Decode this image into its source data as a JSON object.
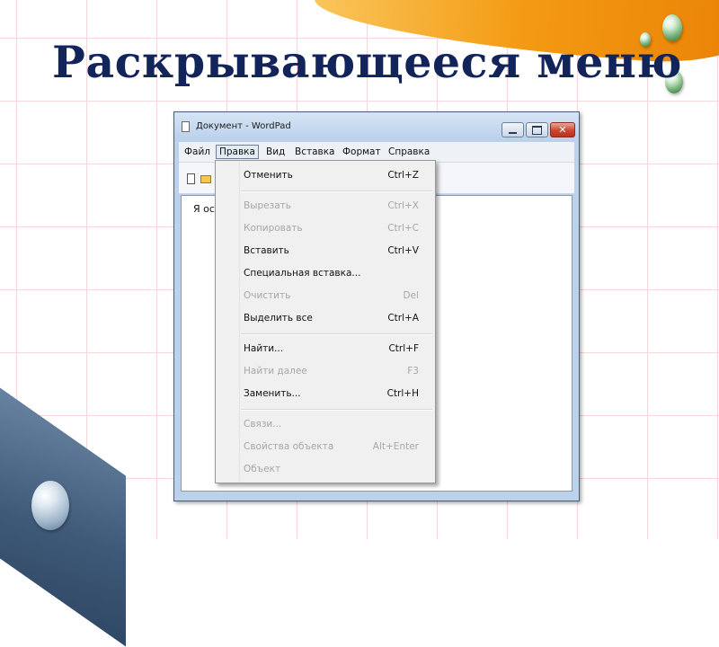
{
  "slide": {
    "title": "Раскрывающееся меню"
  },
  "window": {
    "title": "Документ - WordPad",
    "close_glyph": "✕"
  },
  "menubar": {
    "items": [
      "Файл",
      "Правка",
      "Вид",
      "Вставка",
      "Формат",
      "Справка"
    ],
    "active": "Правка"
  },
  "editor": {
    "text": "Я ос"
  },
  "dropdown": {
    "items": [
      {
        "label": "Отменить",
        "shortcut": "Ctrl+Z",
        "enabled": true
      },
      {
        "label": "Вырезать",
        "shortcut": "Ctrl+X",
        "enabled": false
      },
      {
        "label": "Копировать",
        "shortcut": "Ctrl+C",
        "enabled": false
      },
      {
        "label": "Вставить",
        "shortcut": "Ctrl+V",
        "enabled": true
      },
      {
        "label": "Специальная вставка...",
        "shortcut": "",
        "enabled": true
      },
      {
        "label": "Очистить",
        "shortcut": "Del",
        "enabled": false
      },
      {
        "label": "Выделить все",
        "shortcut": "Ctrl+A",
        "enabled": true
      },
      {
        "label": "Найти...",
        "shortcut": "Ctrl+F",
        "enabled": true
      },
      {
        "label": "Найти далее",
        "shortcut": "F3",
        "enabled": false
      },
      {
        "label": "Заменить...",
        "shortcut": "Ctrl+H",
        "enabled": true
      },
      {
        "label": "Связи...",
        "shortcut": "",
        "enabled": false
      },
      {
        "label": "Свойства объекта",
        "shortcut": "Alt+Enter",
        "enabled": false
      },
      {
        "label": "Объект",
        "shortcut": "",
        "enabled": false
      }
    ]
  },
  "colors": {
    "title": "#13245a",
    "swoosh": "#f49a12",
    "corner": "#3e5877",
    "disabled_text": "#a7a7a7"
  }
}
